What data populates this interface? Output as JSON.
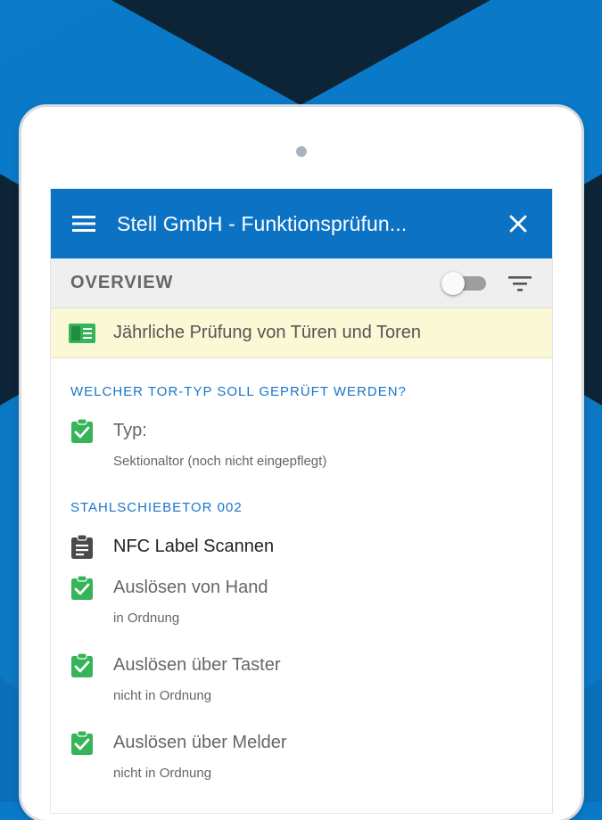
{
  "app": {
    "title": "Stell GmbH - Funktionsprüfun...",
    "colors": {
      "primary": "#0c72c4",
      "accent": "#1976c9",
      "check": "#35b45a",
      "banner": "#fbf8d6"
    }
  },
  "icons": {
    "menu": "hamburger-menu-icon",
    "close": "close-icon",
    "filter": "filter-icon",
    "form": "form-icon",
    "check": "clipboard-check-icon",
    "clipboard": "clipboard-icon"
  },
  "overview": {
    "label": "OVERVIEW",
    "toggle_on": false
  },
  "banner": {
    "text": "Jährliche Prüfung von Türen und Toren"
  },
  "sections": [
    {
      "header": "WELCHER TOR-TYP SOLL GEPRÜFT WERDEN?",
      "items": [
        {
          "title": "Typ:",
          "subtitle": "Sektionaltor (noch nicht eingepflegt)"
        }
      ]
    },
    {
      "header": "STAHLSCHIEBETOR 002",
      "items": [
        {
          "title": "NFC Label Scannen"
        },
        {
          "title": "Auslösen von Hand",
          "subtitle": "in Ordnung"
        },
        {
          "title": "Auslösen über Taster",
          "subtitle": "nicht in Ordnung"
        },
        {
          "title": "Auslösen über Melder",
          "subtitle": "nicht in Ordnung"
        }
      ]
    }
  ]
}
